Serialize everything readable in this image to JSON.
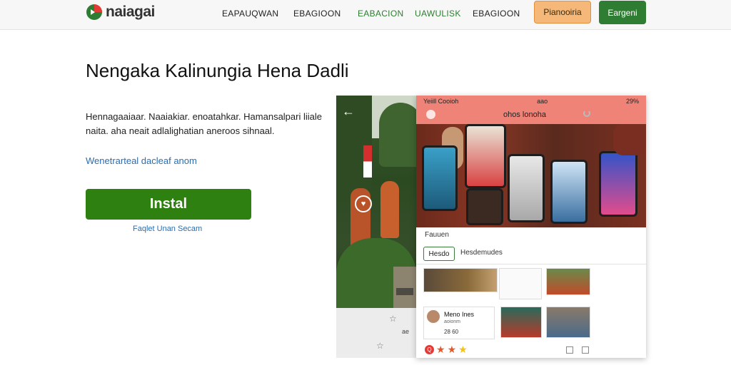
{
  "header": {
    "logo_text": "naiagai",
    "nav": [
      "EAPAUQWAN",
      "EBAGIOON",
      "EABACION",
      "UAWULISK",
      "EBAGIOON"
    ],
    "premium_label": "Pianooiria",
    "login_label": "Eargeni",
    "colors": {
      "brand_green": "#2e7d32",
      "premium_orange": "#f6b878"
    }
  },
  "hero": {
    "title": "Nengaka Kalinungia Hena Dadli",
    "description": "Hennagaaiaar. Naaiakiar. enoatahkar. Hamansalpari liiale naita. aha neait adlalighatian aneroos sihnaal.",
    "link": "Wenetrarteal dacleaf anom",
    "install_label": "Instal",
    "sub_link": "Faqlet Unan Secam"
  },
  "showcase": {
    "status_left": "Yeiill Cooioh",
    "status_mid": "aao",
    "status_right": "29%",
    "app_title": "ohos lonoha",
    "section_label": "Fauuen",
    "chip_label": "Hesdo",
    "chip_side_label": "Hesdemudes",
    "card": {
      "name": "Meno Ines",
      "subtitle": "aoionm",
      "meta": "28  60"
    },
    "rating_badge": "Q",
    "rating_stars": [
      "★",
      "★",
      "★"
    ],
    "below_small": "ae"
  }
}
